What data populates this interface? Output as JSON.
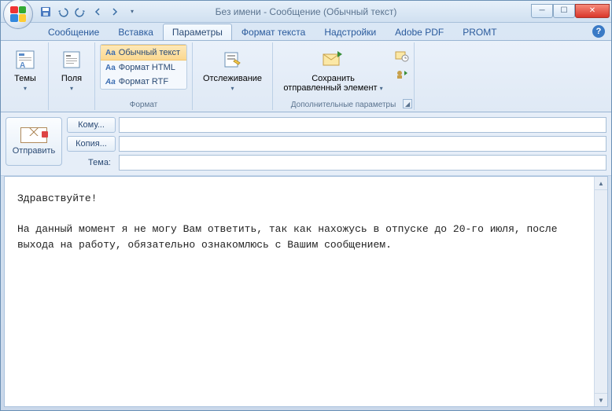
{
  "title": "Без имени - Сообщение (Обычный текст)",
  "qat": {
    "save": "save",
    "undo": "undo",
    "redo": "redo",
    "prev": "prev",
    "next": "next"
  },
  "tabs": {
    "items": [
      {
        "label": "Сообщение"
      },
      {
        "label": "Вставка"
      },
      {
        "label": "Параметры"
      },
      {
        "label": "Формат текста"
      },
      {
        "label": "Надстройки"
      },
      {
        "label": "Adobe PDF"
      },
      {
        "label": "PROMT"
      }
    ],
    "activeIndex": 2
  },
  "ribbon": {
    "themes": {
      "label": "Темы"
    },
    "fields": {
      "label": "Поля"
    },
    "format": {
      "group_label": "Формат",
      "plain": "Обычный текст",
      "html": "Формат HTML",
      "rtf": "Формат RTF"
    },
    "tracking": {
      "label": "Отслеживание"
    },
    "more": {
      "save_sent": "Сохранить\nотправленный элемент",
      "group_label": "Дополнительные параметры"
    }
  },
  "compose": {
    "send": "Отправить",
    "to": "Кому...",
    "cc": "Копия...",
    "subject_label": "Тема:",
    "to_value": "",
    "cc_value": "",
    "subject_value": ""
  },
  "body": "Здравствуйте!\n\nНа данный момент я не могу Вам ответить, так как нахожусь в отпуске до 20-го июля, после выхода на работу, обязательно ознакомлюсь с Вашим сообщением."
}
